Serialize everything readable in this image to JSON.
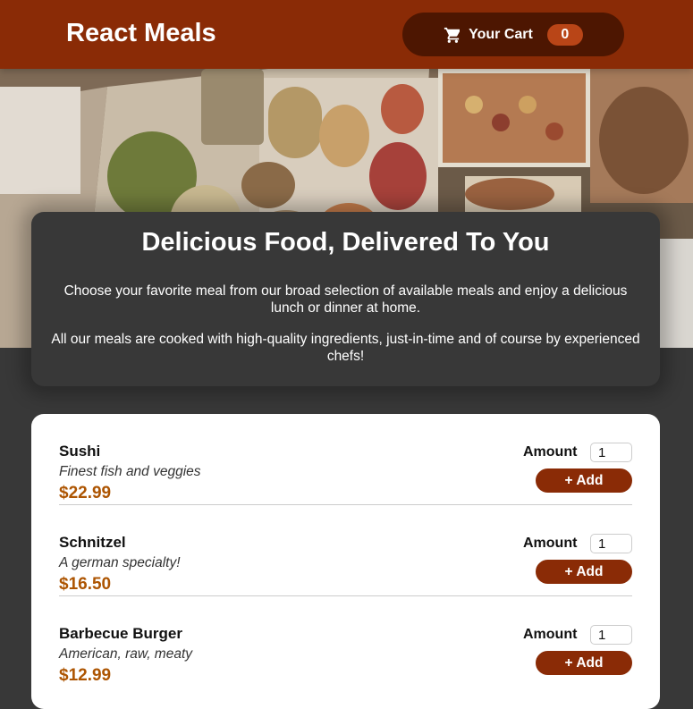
{
  "header": {
    "title": "React Meals",
    "cart": {
      "label": "Your Cart",
      "count": "0",
      "icon": "cart-icon"
    }
  },
  "hero": {
    "image": "banquet-buffet-table-photo"
  },
  "summary": {
    "heading": "Delicious Food, Delivered To You",
    "paragraph1": "Choose your favorite meal from our broad selection of available meals and enjoy a delicious lunch or dinner at home.",
    "paragraph2": "All our meals are cooked with high-quality ingredients, just-in-time and of course by experienced chefs!"
  },
  "meals": {
    "amount_label": "Amount",
    "add_label": "+ Add",
    "items": [
      {
        "name": "Sushi",
        "description": "Finest fish and veggies",
        "price": "$22.99",
        "amount": "1"
      },
      {
        "name": "Schnitzel",
        "description": "A german specialty!",
        "price": "$16.50",
        "amount": "1"
      },
      {
        "name": "Barbecue Burger",
        "description": "American, raw, meaty",
        "price": "$12.99",
        "amount": "1"
      }
    ]
  },
  "colors": {
    "header_bg": "#8a2b06",
    "cart_bg": "#4d1601",
    "badge_bg": "#b94517",
    "page_bg": "#383838",
    "price": "#ad5502"
  }
}
